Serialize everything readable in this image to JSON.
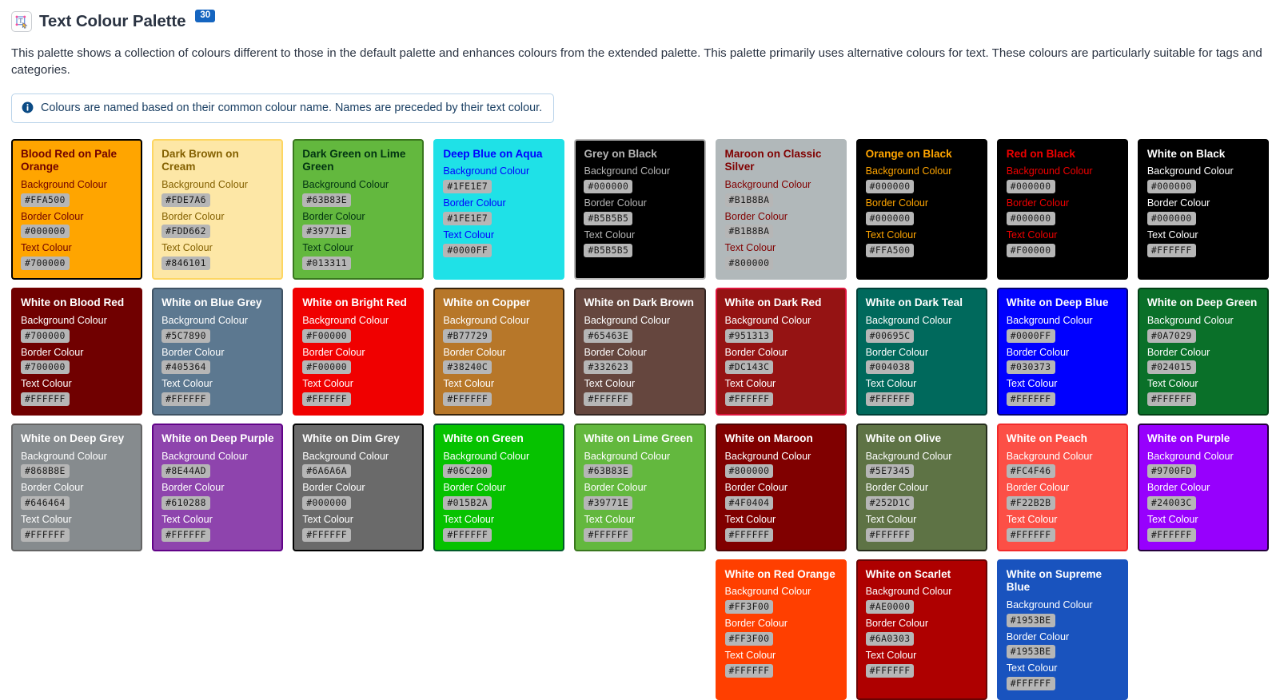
{
  "header": {
    "icon": "text-colour-palette-icon",
    "title": "Text Colour Palette",
    "badge_count": "30"
  },
  "intro": {
    "paragraph": "This palette shows a collection of colours different to those in the default palette and enhances colours from the extended palette. This palette primarily uses alternative colours for text. These colours are particularly suitable for tags and categories."
  },
  "alert": {
    "icon": "info-icon",
    "text": "Colours are named based on their common colour name. Names are preceded by their text colour."
  },
  "labels": {
    "background": "Background Colour",
    "border": "Border Colour",
    "text": "Text Colour"
  },
  "swatches": [
    {
      "name": "Blood Red on Pale Orange",
      "background": "#FFA500",
      "border": "#000000",
      "text": "#700000"
    },
    {
      "name": "Dark Brown on Cream",
      "background": "#FDE7A6",
      "border": "#FDD662",
      "text": "#846101"
    },
    {
      "name": "Dark Green on Lime Green",
      "background": "#63B83E",
      "border": "#39771E",
      "text": "#013311"
    },
    {
      "name": "Deep Blue on Aqua",
      "background": "#1FE1E7",
      "border": "#1FE1E7",
      "text": "#0000FF"
    },
    {
      "name": "Grey on Black",
      "background": "#000000",
      "border": "#B5B5B5",
      "text": "#B5B5B5"
    },
    {
      "name": "Maroon on Classic Silver",
      "background": "#B1B8BA",
      "border": "#B1B8BA",
      "text": "#800000"
    },
    {
      "name": "Orange on Black",
      "background": "#000000",
      "border": "#000000",
      "text": "#FFA500"
    },
    {
      "name": "Red on Black",
      "background": "#000000",
      "border": "#000000",
      "text": "#F00000"
    },
    {
      "name": "White on Black",
      "background": "#000000",
      "border": "#000000",
      "text": "#FFFFFF"
    },
    {
      "name": "White on Blood Red",
      "background": "#700000",
      "border": "#700000",
      "text": "#FFFFFF"
    },
    {
      "name": "White on Blue Grey",
      "background": "#5C7890",
      "border": "#405364",
      "text": "#FFFFFF"
    },
    {
      "name": "White on Bright Red",
      "background": "#F00000",
      "border": "#F00000",
      "text": "#FFFFFF"
    },
    {
      "name": "White on Copper",
      "background": "#B77729",
      "border": "#38240C",
      "text": "#FFFFFF"
    },
    {
      "name": "White on Dark Brown",
      "background": "#65463E",
      "border": "#332623",
      "text": "#FFFFFF"
    },
    {
      "name": "White on Dark Red",
      "background": "#951313",
      "border": "#DC143C",
      "text": "#FFFFFF"
    },
    {
      "name": "White on Dark Teal",
      "background": "#00695C",
      "border": "#004038",
      "text": "#FFFFFF"
    },
    {
      "name": "White on Deep Blue",
      "background": "#0000FF",
      "border": "#030373",
      "text": "#FFFFFF"
    },
    {
      "name": "White on Deep Green",
      "background": "#0A7029",
      "border": "#024015",
      "text": "#FFFFFF"
    },
    {
      "name": "White on Deep Grey",
      "background": "#868B8E",
      "border": "#646464",
      "text": "#FFFFFF"
    },
    {
      "name": "White on Deep Purple",
      "background": "#8E44AD",
      "border": "#610288",
      "text": "#FFFFFF"
    },
    {
      "name": "White on Dim Grey",
      "background": "#6A6A6A",
      "border": "#000000",
      "text": "#FFFFFF"
    },
    {
      "name": "White on Green",
      "background": "#06C200",
      "border": "#015B2A",
      "text": "#FFFFFF"
    },
    {
      "name": "White on Lime Green",
      "background": "#63B83E",
      "border": "#39771E",
      "text": "#FFFFFF"
    },
    {
      "name": "White on Maroon",
      "background": "#800000",
      "border": "#4F0404",
      "text": "#FFFFFF"
    },
    {
      "name": "White on Olive",
      "background": "#5E7345",
      "border": "#252D1C",
      "text": "#FFFFFF"
    },
    {
      "name": "White on Peach",
      "background": "#FC4F46",
      "border": "#F22B2B",
      "text": "#FFFFFF"
    },
    {
      "name": "White on Purple",
      "background": "#9700FD",
      "border": "#24003C",
      "text": "#FFFFFF"
    },
    {
      "name": "White on Red Orange",
      "background": "#FF3F00",
      "border": "#FF3F00",
      "text": "#FFFFFF"
    },
    {
      "name": "White on Scarlet",
      "background": "#AE0000",
      "border": "#6A0303",
      "text": "#FFFFFF"
    },
    {
      "name": "White on Supreme Blue",
      "background": "#1953BE",
      "border": "#1953BE",
      "text": "#FFFFFF"
    }
  ],
  "grid_layout": {
    "columns": 9,
    "row_offsets": [
      0,
      0,
      0,
      5
    ]
  }
}
